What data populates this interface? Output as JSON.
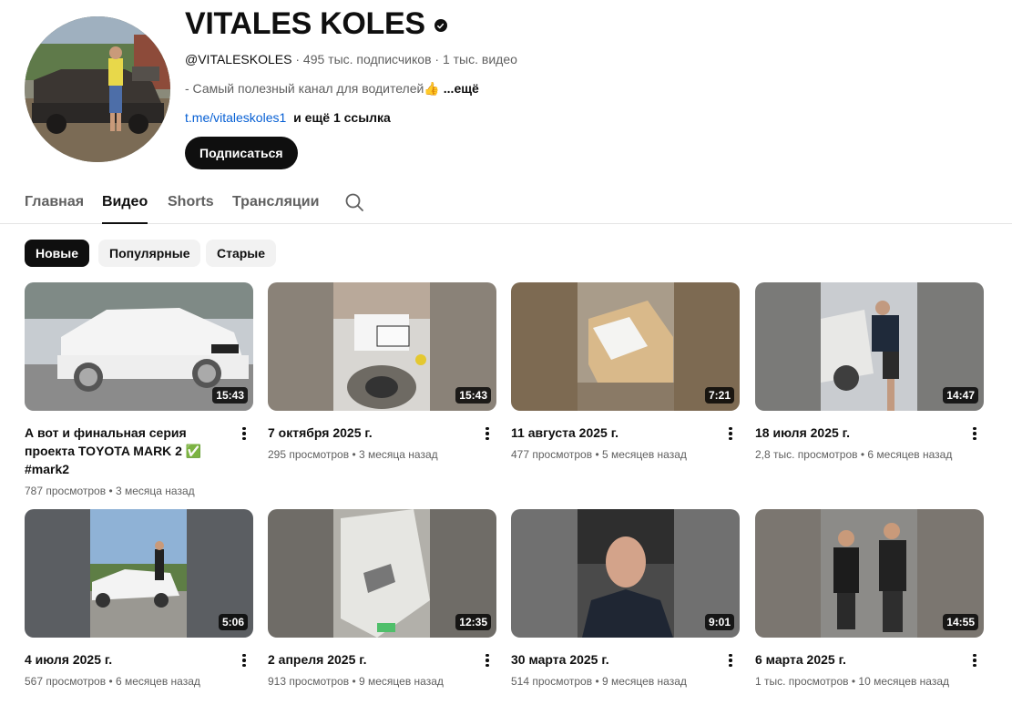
{
  "channel": {
    "name": "VITALES KOLES",
    "handle": "@VITALESKOLES",
    "subscribers": "495 тыс. подписчиков",
    "video_count": "1 тыс. видео",
    "description": "- Самый полезный канал для водителей👍",
    "description_more": "...ещё",
    "link": "t.me/vitaleskoles1",
    "more_links": "и ещё 1 ссылка",
    "subscribe_label": "Подписаться"
  },
  "meta_separator": "·",
  "tabs": [
    {
      "label": "Главная",
      "active": false
    },
    {
      "label": "Видео",
      "active": true
    },
    {
      "label": "Shorts",
      "active": false
    },
    {
      "label": "Трансляции",
      "active": false
    }
  ],
  "chips": [
    {
      "label": "Новые",
      "selected": true
    },
    {
      "label": "Популярные",
      "selected": false
    },
    {
      "label": "Старые",
      "selected": false
    }
  ],
  "videos": [
    {
      "title": "А вот и финальная серия проекта TOYOTA MARK 2 ✅ #mark2",
      "duration": "15:43",
      "views": "787 просмотров",
      "age": "3 месяца назад"
    },
    {
      "title": "7 октября 2025 г.",
      "duration": "15:43",
      "views": "295 просмотров",
      "age": "3 месяца назад"
    },
    {
      "title": "11 августа 2025 г.",
      "duration": "7:21",
      "views": "477 просмотров",
      "age": "5 месяцев назад"
    },
    {
      "title": "18 июля 2025 г.",
      "duration": "14:47",
      "views": "2,8 тыс. просмотров",
      "age": "6 месяцев назад"
    },
    {
      "title": "4 июля 2025 г.",
      "duration": "5:06",
      "views": "567 просмотров",
      "age": "6 месяцев назад"
    },
    {
      "title": "2 апреля 2025 г.",
      "duration": "12:35",
      "views": "913 просмотров",
      "age": "9 месяцев назад"
    },
    {
      "title": "30 марта 2025 г.",
      "duration": "9:01",
      "views": "514 просмотров",
      "age": "9 месяцев назад"
    },
    {
      "title": "6 марта 2025 г.",
      "duration": "14:55",
      "views": "1 тыс. просмотров",
      "age": "10 месяцев назад"
    }
  ],
  "meta_dot": "•",
  "colors": {
    "primary_text": "#0f0f0f",
    "secondary_text": "#606060",
    "link": "#065fd4",
    "chip_bg": "#f2f2f2"
  }
}
